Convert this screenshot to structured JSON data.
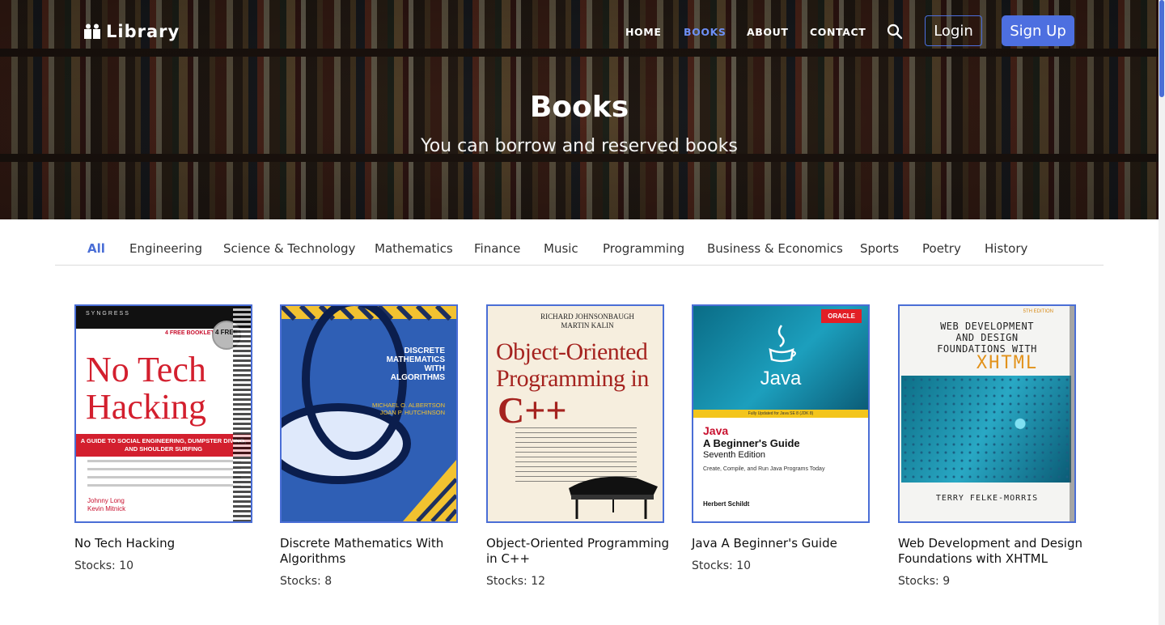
{
  "nav": {
    "logo": "Library",
    "links": [
      "HOME",
      "BOOKS",
      "ABOUT",
      "CONTACT"
    ],
    "active_link": "BOOKS",
    "login": "Login",
    "signup": "Sign Up"
  },
  "hero": {
    "title": "Books",
    "subtitle": "You can borrow and reserved books"
  },
  "categories": [
    "All",
    "Engineering",
    "Science & Technology",
    "Mathematics",
    "Finance",
    "Music",
    "Programming",
    "Business & Economics",
    "Sports",
    "Poetry",
    "History"
  ],
  "active_category": "All",
  "colors": {
    "accent": "#4a6ed6",
    "signup_bg": "#4d6fe0",
    "active_nav": "#6d8ff5"
  },
  "books": [
    {
      "title": "No Tech Hacking",
      "stocks": "Stocks: 10",
      "cover": {
        "publisher": "SYNGRESS",
        "badge": "4 FREE BOOKLETS",
        "seal": "4 FREE",
        "title_line1": "No Tech",
        "title_line2": "Hacking",
        "band": "A GUIDE TO SOCIAL ENGINEERING, DUMPSTER DIVING, AND SHOULDER SURFING",
        "author1": "Johnny Long",
        "author2": "Kevin Mitnick"
      }
    },
    {
      "title": "Discrete Mathematics With Algorithms",
      "stocks": "Stocks: 8",
      "cover": {
        "line1": "DISCRETE",
        "line2": "MATHEMATICS",
        "line3": "WITH",
        "line4": "ALGORITHMS",
        "author1": "MICHAEL O. ALBERTSON",
        "author2": "JOAN P. HUTCHINSON"
      }
    },
    {
      "title": "Object-Oriented Programming in C++",
      "stocks": "Stocks: 12",
      "cover": {
        "author1": "RICHARD JOHNSONBAUGH",
        "author2": "MARTIN KALIN",
        "line1": "Object-Oriented",
        "line2": "Programming in",
        "line3": "C++"
      }
    },
    {
      "title": "Java A Beginner's Guide",
      "stocks": "Stocks: 10",
      "cover": {
        "brand": "ORACLE",
        "logo_text": "Java",
        "bar": "Fully Updated for Java SE 8 (JDK 8)",
        "line1": "Java",
        "line2": "A Beginner's Guide",
        "edition": "Seventh Edition",
        "tagline": "Create, Compile, and Run Java Programs Today",
        "author": "Herbert Schildt"
      }
    },
    {
      "title": "Web Development and Design Foundations with XHTML",
      "stocks": "Stocks: 9",
      "cover": {
        "edition": "5TH EDITION",
        "line1": "WEB DEVELOPMENT",
        "line2": "AND DESIGN",
        "line3": "FOUNDATIONS WITH",
        "line4": "XHTML",
        "author": "TERRY FELKE-MORRIS"
      }
    }
  ]
}
